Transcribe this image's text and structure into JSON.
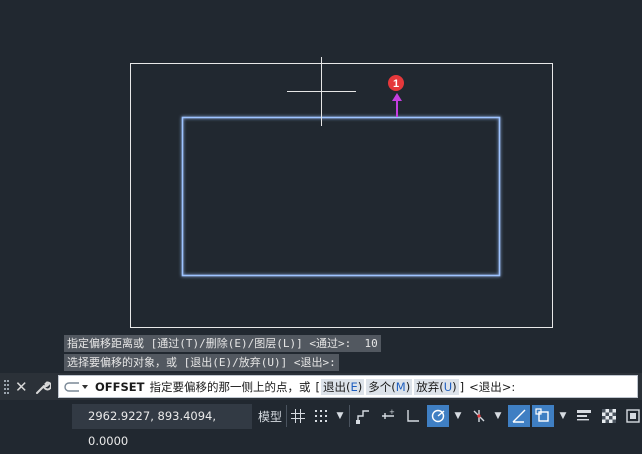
{
  "canvas": {
    "marker_label": "1",
    "colors": {
      "background": "#212830",
      "outer_rect": "#e8e8e8",
      "inner_rect": "#9ec3ff",
      "arrow": "#c43ee0",
      "marker": "#e5383b"
    }
  },
  "history": [
    "指定偏移距离或 [通过(T)/删除(E)/图层(L)] <通过>:  10",
    "选择要偏移的对象，或 [退出(E)/放弃(U)] <退出>:"
  ],
  "command_line": {
    "command": "OFFSET",
    "prompt": "指定要偏移的那一侧上的点，或",
    "open_bracket": "[",
    "options": [
      {
        "label": "退出",
        "key": "E"
      },
      {
        "label": "多个",
        "key": "M"
      },
      {
        "label": "放弃",
        "key": "U"
      }
    ],
    "close_bracket": "]",
    "default_text": "<退出>:"
  },
  "status_bar": {
    "coordinates": "2962.9227, 893.4094, 0.0000",
    "model_label": "模型"
  }
}
